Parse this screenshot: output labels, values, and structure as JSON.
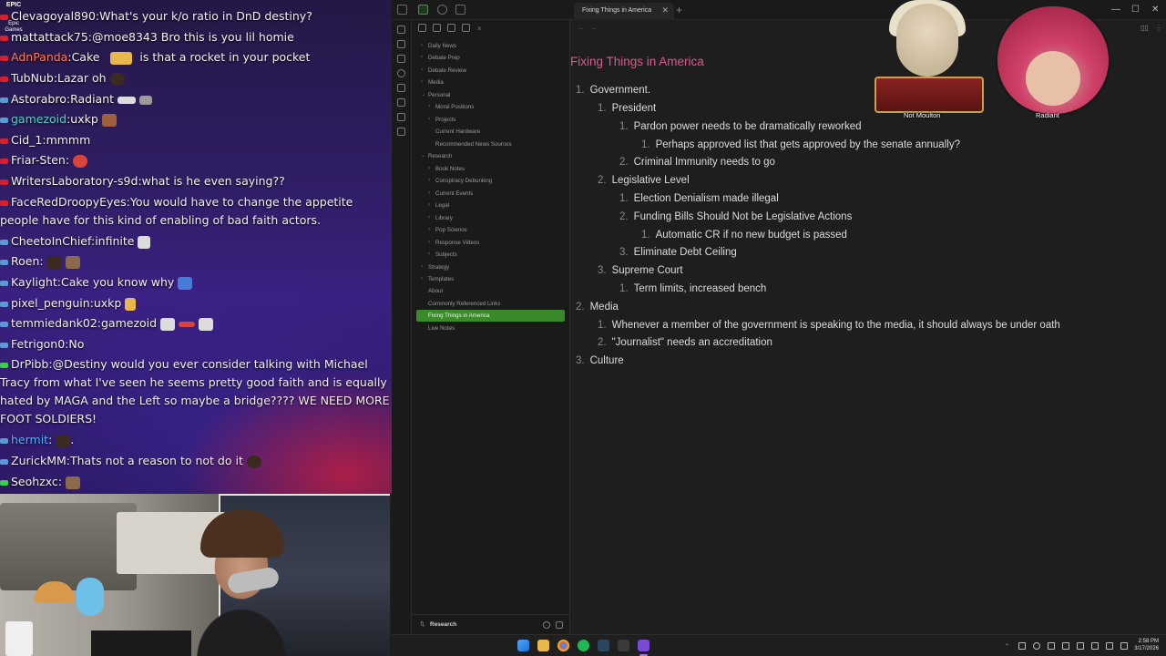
{
  "chat": {
    "logo_top": "EPIC",
    "logo_bottom": "Epic Games",
    "messages": [
      {
        "user": "Clevagoyal890",
        "text": "What's your k/o ratio in DnD destiny?",
        "color": "#f2f2f2"
      },
      {
        "user": "mattattack75",
        "text": "@moe8343 Bro this is you lil homie",
        "color": "#f2f2f2"
      },
      {
        "user": "AdnPanda",
        "text": "Cake",
        "tail": "is that a rocket in your pocket",
        "color": "#ff7a5a"
      },
      {
        "user": "TubNub",
        "text": "Lazar oh",
        "color": "#f2f2f2"
      },
      {
        "user": "Astorabro",
        "text": "Radiant",
        "color": "#f2f2f2"
      },
      {
        "user": "gamezoid",
        "text": "uxkp",
        "color": "#46d8c8"
      },
      {
        "user": "Cid_1",
        "text": "mmmm",
        "color": "#f2f2f2"
      },
      {
        "user": "Friar-Sten",
        "text": "",
        "color": "#f2f2f2"
      },
      {
        "user": "WritersLaboratory-s9d",
        "text": "what is he even saying??",
        "color": "#f2f2f2"
      },
      {
        "user": "FaceRedDroopyEyes",
        "text": "You would have to change the appetite people have for this kind of enabling of bad faith actors.",
        "color": "#f2f2f2"
      },
      {
        "user": "CheetoInChief",
        "text": "infinite",
        "color": "#f2f2f2"
      },
      {
        "user": "Roen",
        "text": "",
        "color": "#f2f2f2"
      },
      {
        "user": "Kaylight",
        "text": "Cake you know why",
        "color": "#f2f2f2"
      },
      {
        "user": "pixel_penguin",
        "text": "uxkp",
        "color": "#f2f2f2"
      },
      {
        "user": "temmiedank02",
        "text": "gamezoid",
        "color": "#f2f2f2"
      },
      {
        "user": "Fetrigon0",
        "text": "No",
        "color": "#f2f2f2"
      },
      {
        "user": "DrPibb",
        "text": "@Destiny would you ever consider talking with Michael Tracy from what I've seen he seems pretty good faith and is equally hated by MAGA and the Left so maybe a bridge???? WE NEED MORE FOOT SOLDIERS!",
        "color": "#f2f2f2"
      },
      {
        "user": "hermit",
        "text": ".",
        "color": "#5bb0ff"
      },
      {
        "user": "ZurickMM",
        "text": "Thats not a reason to not do it",
        "color": "#f2f2f2"
      },
      {
        "user": "Seohzxc",
        "text": "",
        "color": "#f2f2f2"
      }
    ]
  },
  "obsidian": {
    "tab_title": "Fixing Things in America",
    "tab_close": "✕",
    "tab_add": "+",
    "window_controls": [
      "—",
      "☐",
      "✕"
    ],
    "sidebar": {
      "items": [
        {
          "label": "Daily News",
          "chev": "›"
        },
        {
          "label": "Debate Prep",
          "chev": "›"
        },
        {
          "label": "Debate Review",
          "chev": "›"
        },
        {
          "label": "Media",
          "chev": "›"
        },
        {
          "label": "Personal",
          "chev": "⌄"
        },
        {
          "label": "Moral Positions",
          "chev": "›"
        },
        {
          "label": "Projects",
          "chev": "›"
        },
        {
          "label": "Current Hardware",
          "chev": ""
        },
        {
          "label": "Recommended News Sources",
          "chev": ""
        },
        {
          "label": "Research",
          "chev": "⌄"
        },
        {
          "label": "Book Notes",
          "chev": "›"
        },
        {
          "label": "Conspiracy Debunking",
          "chev": "›"
        },
        {
          "label": "Current Events",
          "chev": "›"
        },
        {
          "label": "Legal",
          "chev": "›"
        },
        {
          "label": "Library",
          "chev": "›"
        },
        {
          "label": "Pop Science",
          "chev": "›"
        },
        {
          "label": "Response Videos",
          "chev": "›"
        },
        {
          "label": "Subjects",
          "chev": "›"
        },
        {
          "label": "Strategy",
          "chev": "›"
        },
        {
          "label": "Templates",
          "chev": "›"
        },
        {
          "label": "About",
          "chev": ""
        },
        {
          "label": "Commonly Referenced Links",
          "chev": ""
        },
        {
          "label": "Fixing Things in America",
          "chev": ""
        },
        {
          "label": "Live Notes",
          "chev": ""
        }
      ],
      "footer_label": "Research"
    },
    "note": {
      "title": "Fixing Things in America",
      "items": [
        {
          "num": "1.",
          "text": "Government."
        },
        {
          "num": "1.",
          "text": "President"
        },
        {
          "num": "1.",
          "text": "Pardon power needs to be dramatically reworked"
        },
        {
          "num": "1.",
          "text": "Perhaps approved list that gets approved by the senate annually?"
        },
        {
          "num": "2.",
          "text": "Criminal Immunity needs to go"
        },
        {
          "num": "2.",
          "text": "Legislative Level"
        },
        {
          "num": "1.",
          "text": "Election Denialism made illegal"
        },
        {
          "num": "2.",
          "text": "Funding Bills Should Not be Legislative Actions"
        },
        {
          "num": "1.",
          "text": "Automatic CR if no new budget is passed"
        },
        {
          "num": "3.",
          "text": "Eliminate Debt Ceiling"
        },
        {
          "num": "3.",
          "text": "Supreme Court"
        },
        {
          "num": "1.",
          "text": "Term limits, increased bench"
        },
        {
          "num": "2.",
          "text": "Media"
        },
        {
          "num": "1.",
          "text": "Whenever a member of the government is speaking to the media, it should always be under oath"
        },
        {
          "num": "2.",
          "text": "\"Journalist\" needs an accreditation"
        },
        {
          "num": "3.",
          "text": "Culture"
        }
      ]
    },
    "avatars": {
      "left_label": "Not Moulton",
      "right_label": "Radiant"
    }
  },
  "taskbar": {
    "time": "2:58 PM",
    "date": "3/17/2026"
  }
}
